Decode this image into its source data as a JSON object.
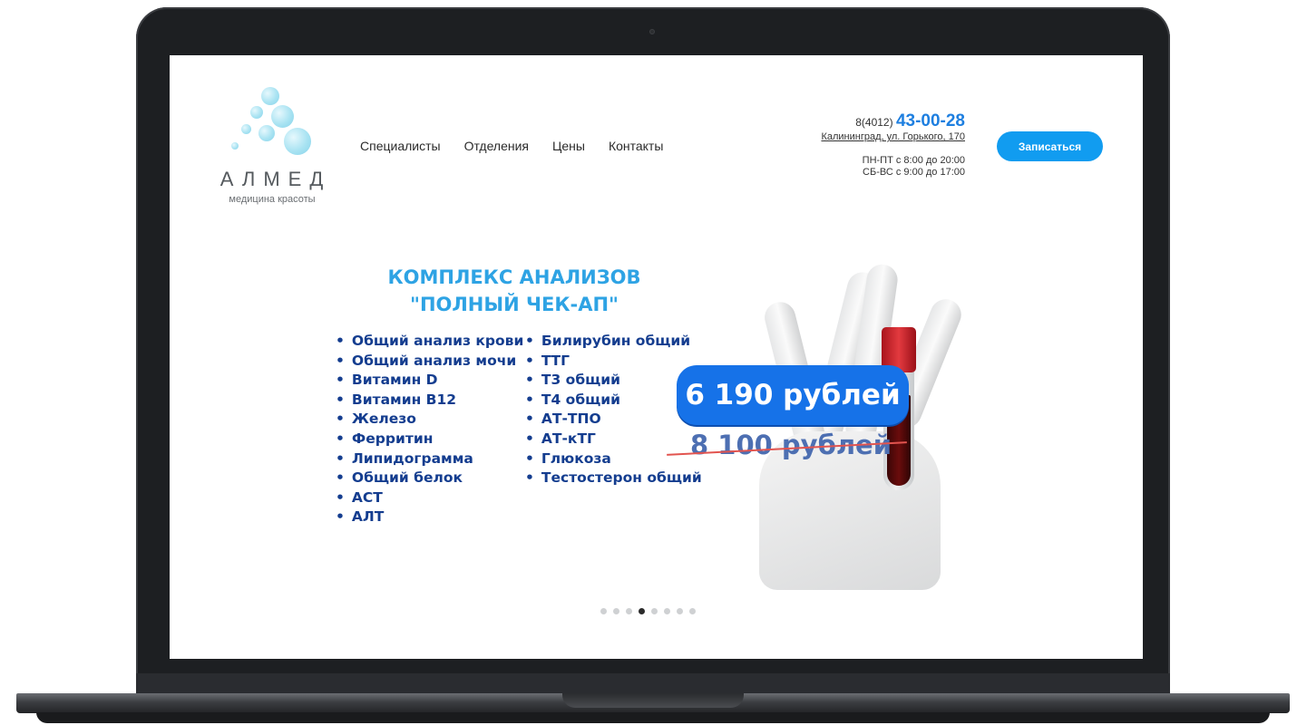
{
  "logo": {
    "name": "АЛМЕД",
    "tagline": "медицина красоты"
  },
  "nav": {
    "items": [
      "Специалисты",
      "Отделения",
      "Цены",
      "Контакты"
    ]
  },
  "contact": {
    "phone_prefix": "8(4012)",
    "phone_number": "43-00-28",
    "address": "Калининград, ул. Горького, 170",
    "hours_weekdays": "ПН-ПТ с 8:00 до 20:00",
    "hours_weekend": "СБ-ВС с 9:00 до 17:00"
  },
  "cta": {
    "label": "Записаться"
  },
  "banner": {
    "title_line1": "КОМПЛЕКС АНАЛИЗОВ",
    "title_line2": "\"ПОЛНЫЙ ЧЕК-АП\"",
    "col1": [
      "Общий анализ крови",
      "Общий анализ мочи",
      "Витамин D",
      "Витамин B12",
      "Железо",
      "Ферритин",
      "Липидограмма",
      "Общий белок",
      "АСТ",
      "АЛТ"
    ],
    "col2": [
      "Билирубин общий",
      "ТТГ",
      "Т3 общий",
      "Т4 общий",
      "АТ-ТПО",
      "АТ-кТГ",
      "Глюкоза",
      "Тестостерон общий"
    ],
    "price_new": "6 190 рублей",
    "price_old": "8 100 рублей"
  },
  "slider": {
    "count": 8,
    "active_index": 3
  },
  "colors": {
    "accent": "#119cf0",
    "phone": "#1e7fe0",
    "list_text": "#143d8f",
    "title": "#2ea3e4"
  }
}
